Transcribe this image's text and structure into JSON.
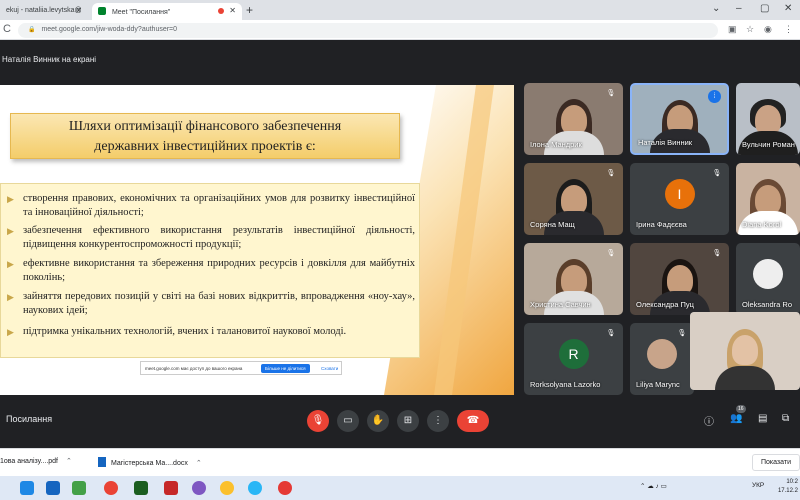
{
  "browser": {
    "tabs": [
      {
        "label": "ekuj - nataliia.levytska@"
      },
      {
        "label": "Meet \"Посилання\""
      }
    ],
    "new_tab_label": "+",
    "address": "meet.google.com/jiw-woda-ddy?authuser=0",
    "window_controls": [
      "⌄",
      "–",
      "▢",
      "✕"
    ]
  },
  "meet": {
    "presenter_label": "Наталія Винник на екрані",
    "meeting_name": "Посилання",
    "share_bar": {
      "text": "meet.google.com має доступ до вашого екрана",
      "stop_label": "Більше не ділитися",
      "hide_label": "Сховати"
    },
    "participant_count": "16"
  },
  "slide": {
    "title_line1": "Шляхи оптимізації фінансового забезпечення",
    "title_line2": "державних інвестиційних проектів є:",
    "items": [
      "створення правових, економічних та організаційних умов для розвитку інвестиційної та інноваційної діяльності;",
      "забезпечення ефективного використання результатів інвестиційної діяльності, підвищення конкурентоспроможності продукції;",
      "ефективне використання та збереження природних ресурсів і довкілля для майбутніх поколінь;",
      "зайняття передових позицій у світі на базі нових відкриттів, впровадження «ноу-хау», наукових ідей;",
      "підтримка унікальних технологій, вчених і талановитої наукової молоді."
    ]
  },
  "participants": [
    {
      "name": "Ілона Мандрик"
    },
    {
      "name": "Наталія Винник"
    },
    {
      "name": "Вульчин Роман"
    },
    {
      "name": "Соряна Мащ"
    },
    {
      "name": "Ірина Фадєєва",
      "initial": "І",
      "color": "#e8710a"
    },
    {
      "name": "Diana Korol"
    },
    {
      "name": "Христина Савчин"
    },
    {
      "name": "Олександра Пуц"
    },
    {
      "name": "Oleksandra Ro"
    },
    {
      "name": "Rorksolyana Lazorko",
      "initial": "R",
      "color": "#1e6e3a"
    },
    {
      "name": "Liliya Marync"
    }
  ],
  "downloads": [
    {
      "label": "1ова аналізу....pdf",
      "color": "#e53935"
    },
    {
      "label": "Магістерська Ма....docx",
      "color": "#1565c0"
    }
  ],
  "downloads_show_all": "Показати",
  "taskbar": {
    "lang": "УКР",
    "time": "10:2",
    "date": "17.12.2"
  },
  "icons": {
    "mic_off": "mic-off-icon",
    "camera": "camera-icon",
    "hand": "raise-hand-icon",
    "present": "present-icon",
    "more": "more-icon",
    "end_call": "end-call-icon"
  }
}
